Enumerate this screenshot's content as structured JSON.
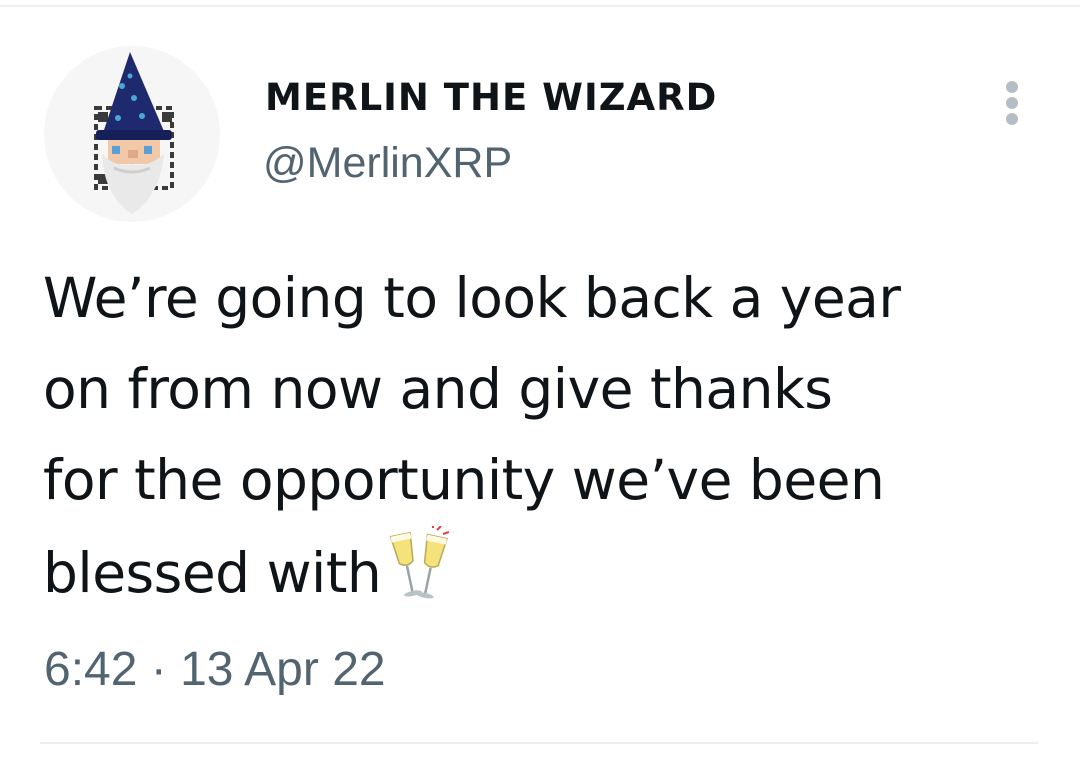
{
  "tweet": {
    "display_name": "MERLIN THE WIZARD",
    "handle": "@MerlinXRP",
    "text_lines": [
      "We’re going to look back a year",
      "on from now and give thanks",
      "for the opportunity we’ve been",
      "blessed with"
    ],
    "emoji": "clinking-glasses-icon",
    "timestamp": "6:42 · 13 Apr 22"
  },
  "colors": {
    "text_primary": "#0f1419",
    "text_secondary": "#536471",
    "divider": "#eceff1",
    "hat": "#1f2a6e",
    "hat_dots": "#4aa8d8"
  }
}
